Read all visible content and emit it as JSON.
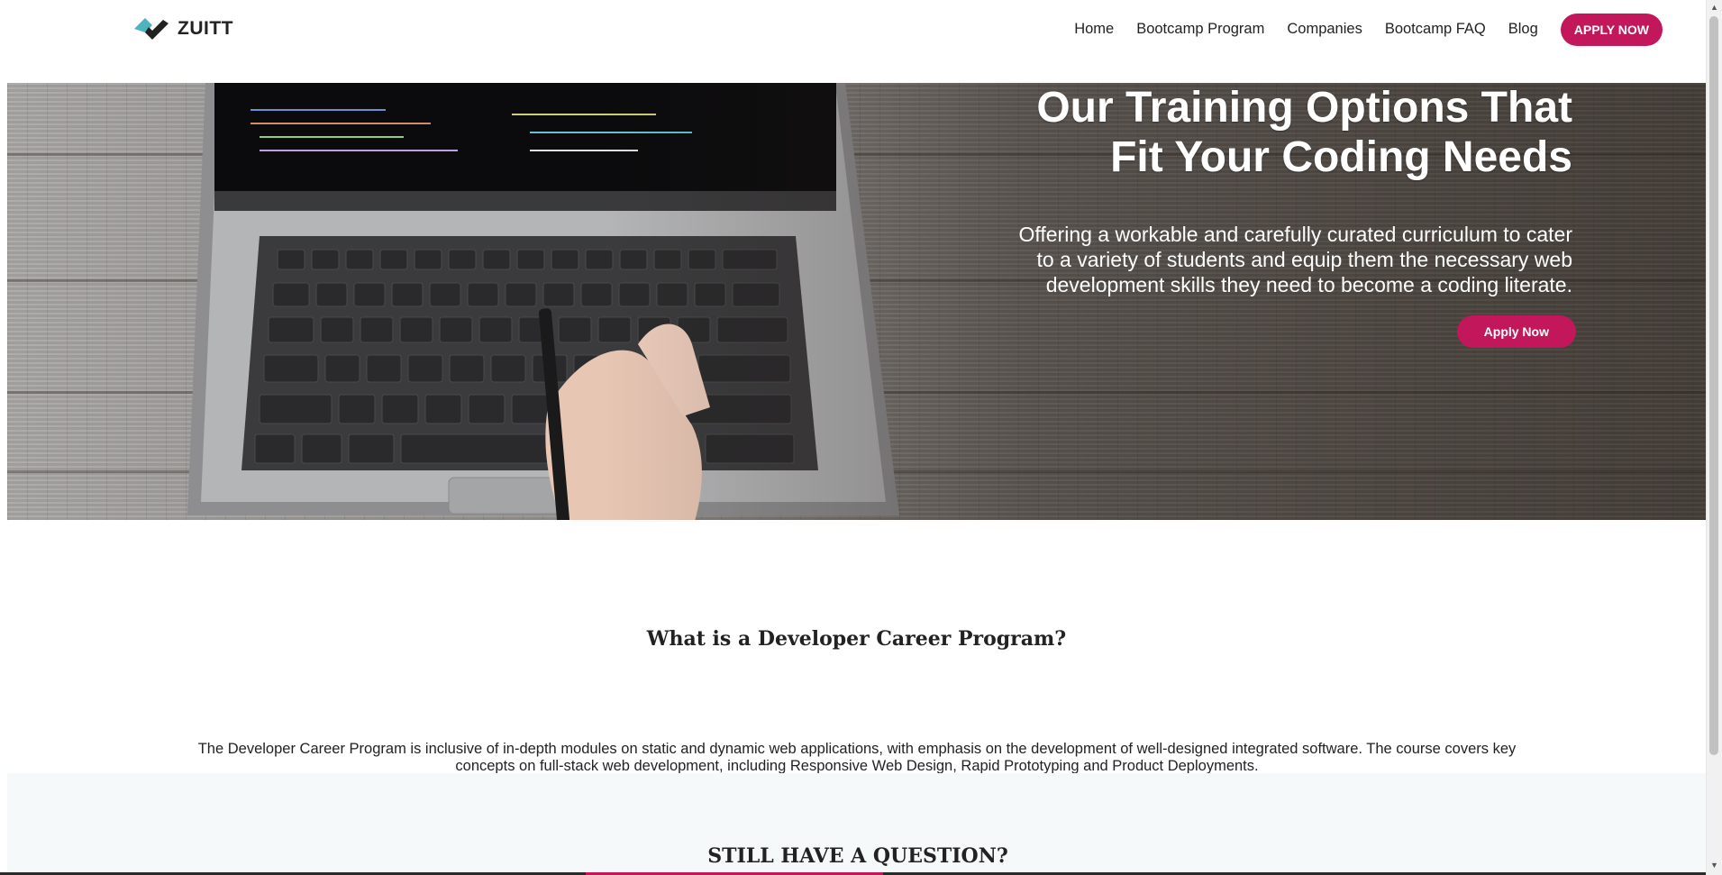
{
  "brand": {
    "name": "ZUITT",
    "colors": {
      "accent": "#c2185b",
      "logo_teal": "#4fb3bf",
      "logo_dark": "#222222"
    }
  },
  "nav": {
    "items": [
      "Home",
      "Bootcamp Program",
      "Companies",
      "Bootcamp FAQ",
      "Blog"
    ],
    "cta": "APPLY NOW"
  },
  "hero": {
    "title": "Our Training Options That Fit Your Coding Needs",
    "subtitle": "Offering a workable and carefully curated curriculum to cater to a variety of students and equip them the necessary web development skills they need to become a coding literate.",
    "button": "Apply Now"
  },
  "program": {
    "title": "What is a Developer Career Program?",
    "body": "The Developer Career Program is inclusive of in-depth modules on static and dynamic web applications, with emphasis on the development of well-designed integrated software. The course covers key concepts on full-stack web development, including Responsive Web Design, Rapid Prototyping and Product Deployments."
  },
  "question": {
    "title": "STILL HAVE A QUESTION?"
  }
}
